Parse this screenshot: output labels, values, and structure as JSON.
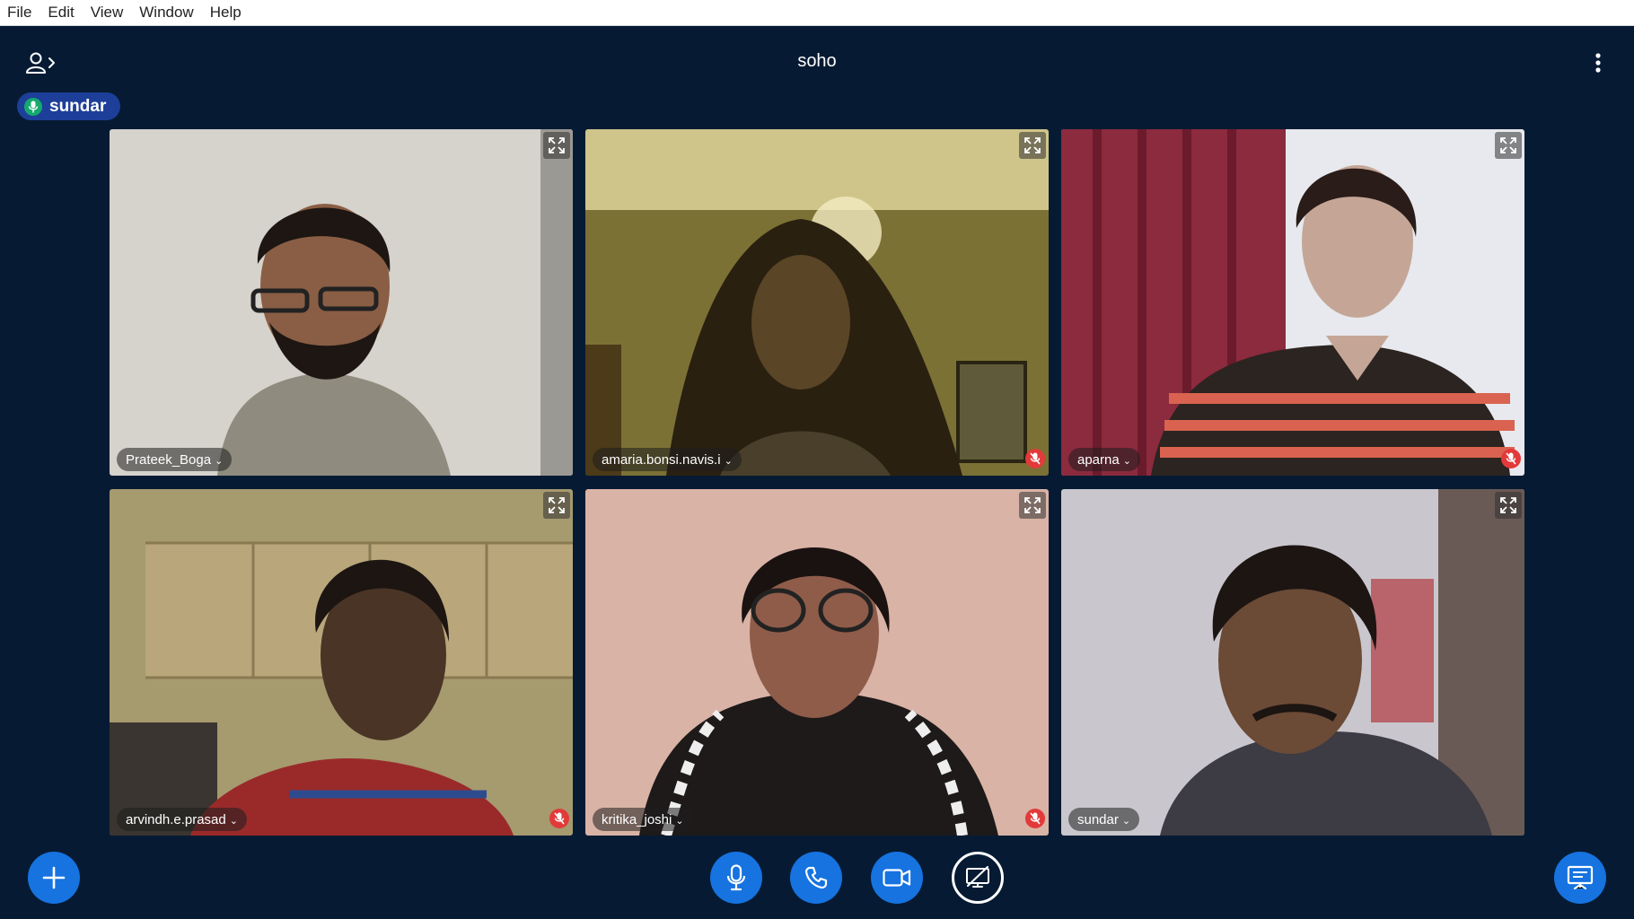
{
  "menu": [
    "File",
    "Edit",
    "View",
    "Window",
    "Help"
  ],
  "header": {
    "title": "soho"
  },
  "active_speaker": {
    "name": "sundar"
  },
  "participants": [
    {
      "name": "Prateek_Boga",
      "muted": false
    },
    {
      "name": "amaria.bonsi.navis.i",
      "muted": true
    },
    {
      "name": "aparna",
      "muted": true
    },
    {
      "name": "arvindh.e.prasad",
      "muted": true
    },
    {
      "name": "kritika_joshi",
      "muted": true
    },
    {
      "name": "sundar",
      "muted": false
    }
  ],
  "controls": {
    "add": "plus-icon",
    "mic": "microphone-icon",
    "call": "phone-icon",
    "video": "video-camera-icon",
    "screen_share": "screen-share-off-icon",
    "presentation": "presentation-icon"
  },
  "colors": {
    "background": "#061b33",
    "accent": "#1673e0",
    "speaker_badge": "#1d3f99",
    "mute_badge": "#e23a3a"
  }
}
